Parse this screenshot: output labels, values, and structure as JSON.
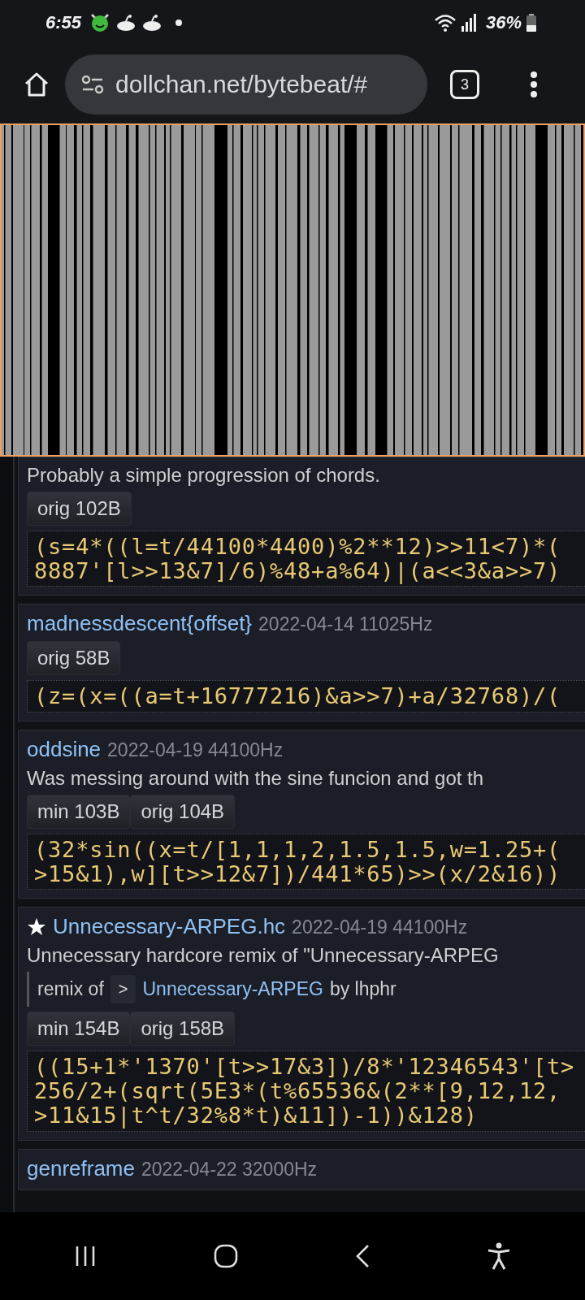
{
  "status_bar": {
    "time": "6:55",
    "battery": "36%"
  },
  "browser": {
    "url": "dollchan.net/bytebeat/#",
    "tab_count": "3"
  },
  "posts": [
    {
      "description": "Probably a simple progression of chords.",
      "sizes": [
        {
          "label": "orig 102B"
        }
      ],
      "code_lines": [
        "(s=4*((l=t/44100*4400)%2**12)>>11<7)*(",
        "8887'[l>>13&7]/6)%48+a%64)|(a<<3&a>>7)"
      ]
    },
    {
      "title": "madnessdescent{offset}",
      "starred": false,
      "meta": "2022-04-14 11025Hz",
      "sizes": [
        {
          "label": "orig 58B"
        }
      ],
      "code_lines": [
        "(z=(x=((a=t+16777216)&a>>7)+a/32768)/("
      ]
    },
    {
      "title": "oddsine",
      "starred": false,
      "meta": "2022-04-19 44100Hz",
      "description": "Was messing around with the sine funcion and got th",
      "sizes": [
        {
          "label": "min 103B"
        },
        {
          "label": "orig 104B"
        }
      ],
      "code_lines": [
        "(32*sin((x=t/[1,1,1,2,1.5,1.5,w=1.25+(",
        ">15&1),w][t>>12&7])/441*65)>>(x/2&16))"
      ]
    },
    {
      "title": "Unnecessary-ARPEG.hc",
      "starred": true,
      "meta": "2022-04-19 44100Hz",
      "description": "Unnecessary hardcore remix of \"Unnecessary-ARPEG",
      "remix": {
        "label": "remix of",
        "button": ">",
        "link": "Unnecessary-ARPEG",
        "author": "by lhphr"
      },
      "sizes": [
        {
          "label": "min 154B"
        },
        {
          "label": "orig 158B"
        }
      ],
      "code_lines": [
        "((15+1*'1370'[t>>17&3])/8*'12346543'[t>",
        "256/2+(sqrt(5E3*(t%65536&(2**[9,12,12,",
        ">11&15|t^t/32%8*t)&11])-1))&128)"
      ]
    },
    {
      "title": "genreframe",
      "starred": false,
      "meta": "2022-04-22 32000Hz"
    }
  ]
}
